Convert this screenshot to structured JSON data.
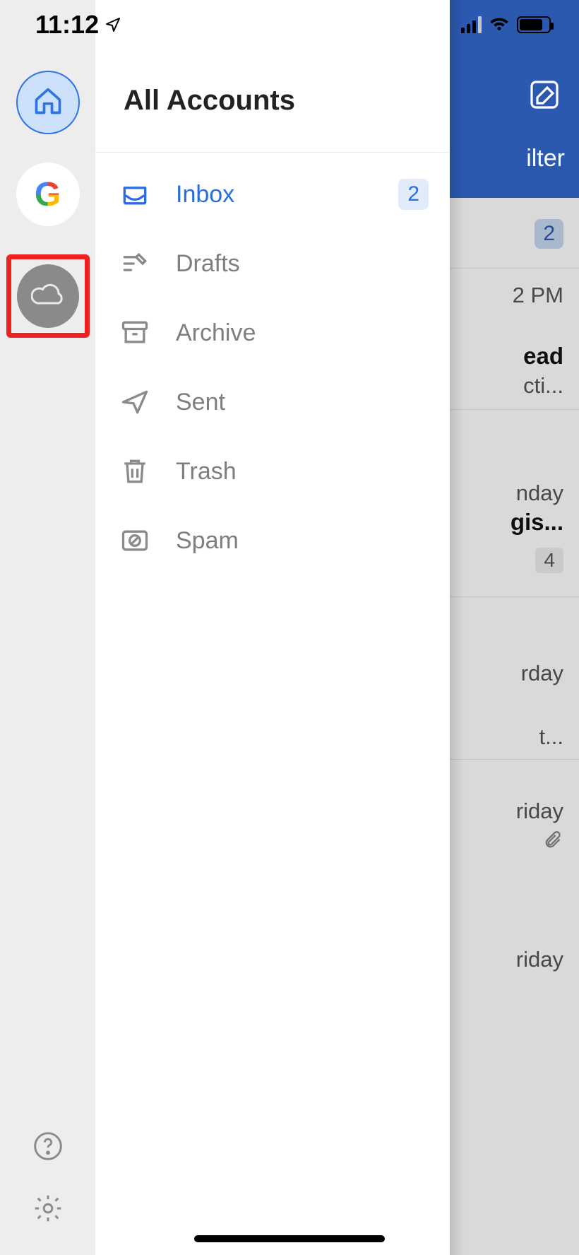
{
  "status": {
    "time": "11:12"
  },
  "drawer": {
    "title": "All Accounts",
    "folders": [
      {
        "label": "Inbox",
        "count": "2"
      },
      {
        "label": "Drafts"
      },
      {
        "label": "Archive"
      },
      {
        "label": "Sent"
      },
      {
        "label": "Trash"
      },
      {
        "label": "Spam"
      }
    ]
  },
  "rail": {
    "home_icon": "home-icon",
    "google_glyph": "G",
    "cloud_icon": "cloud-icon",
    "help_icon": "help-icon",
    "settings_icon": "gear-icon"
  },
  "background": {
    "filter_label": "ilter",
    "top_badge": "2",
    "rows": [
      {
        "time": "2 PM",
        "line1": "ead",
        "line2": "cti..."
      },
      {
        "time": "nday",
        "line1": "gis...",
        "badge": "4"
      },
      {
        "time": "rday"
      },
      {
        "time": "",
        "line1": "t..."
      },
      {
        "time": "riday",
        "attachment": true
      },
      {
        "time": "riday"
      }
    ]
  }
}
